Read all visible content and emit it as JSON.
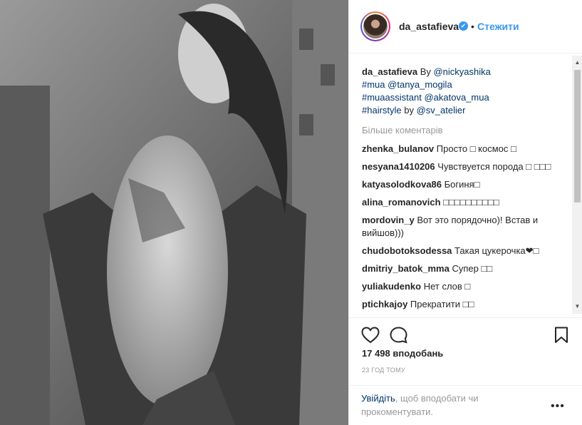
{
  "header": {
    "username": "da_astafieva",
    "verified_glyph": "✔",
    "separator": "•",
    "follow_label": "Стежити"
  },
  "caption": {
    "username": "da_astafieva",
    "line1_text": "By ",
    "line1_mention": "@nickyashika",
    "line2_tag": "#mua",
    "line2_mention": "@tanya_mogila",
    "line3_tag": "#muaassistant",
    "line3_mention": "@akatova_mua",
    "line4_tag": "#hairstyle",
    "line4_text": " by ",
    "line4_mention": "@sv_atelier"
  },
  "more_comments_label": "Більше коментарів",
  "comments": [
    {
      "user": "zhenka_bulanov",
      "text": "Просто □ космос □"
    },
    {
      "user": "nesyana1410206",
      "text": "Чувствуется порода □ □□□"
    },
    {
      "user": "katyasolodkova86",
      "text": "Богиня□"
    },
    {
      "user": "alina_romanovich",
      "text": "□□□□□□□□□□"
    },
    {
      "user": "mordovin_y",
      "text": "Вот это порядочно)! Встав и вийшов)))"
    },
    {
      "user": "chudobotoksodessa",
      "text": "Такая цукерочка❤□"
    },
    {
      "user": "dmitriy_batok_mma",
      "text": "Супер □□"
    },
    {
      "user": "yuliakudenko",
      "text": "Нет слов □"
    },
    {
      "user": "ptichkajoy",
      "text": "Прекратити □□"
    }
  ],
  "likes_label": "17 498 вподобань",
  "time_label": "23 ГОД ТОМУ",
  "footer": {
    "login_link": "Увійдіть",
    "login_text": ", щоб вподобати чи прокоментувати.",
    "options_glyph": "•••"
  },
  "icons": {
    "heart": "heart-icon",
    "comment": "comment-icon",
    "bookmark": "bookmark-icon"
  },
  "colors": {
    "accent": "#3897f0",
    "link": "#003569",
    "muted": "#999999"
  }
}
